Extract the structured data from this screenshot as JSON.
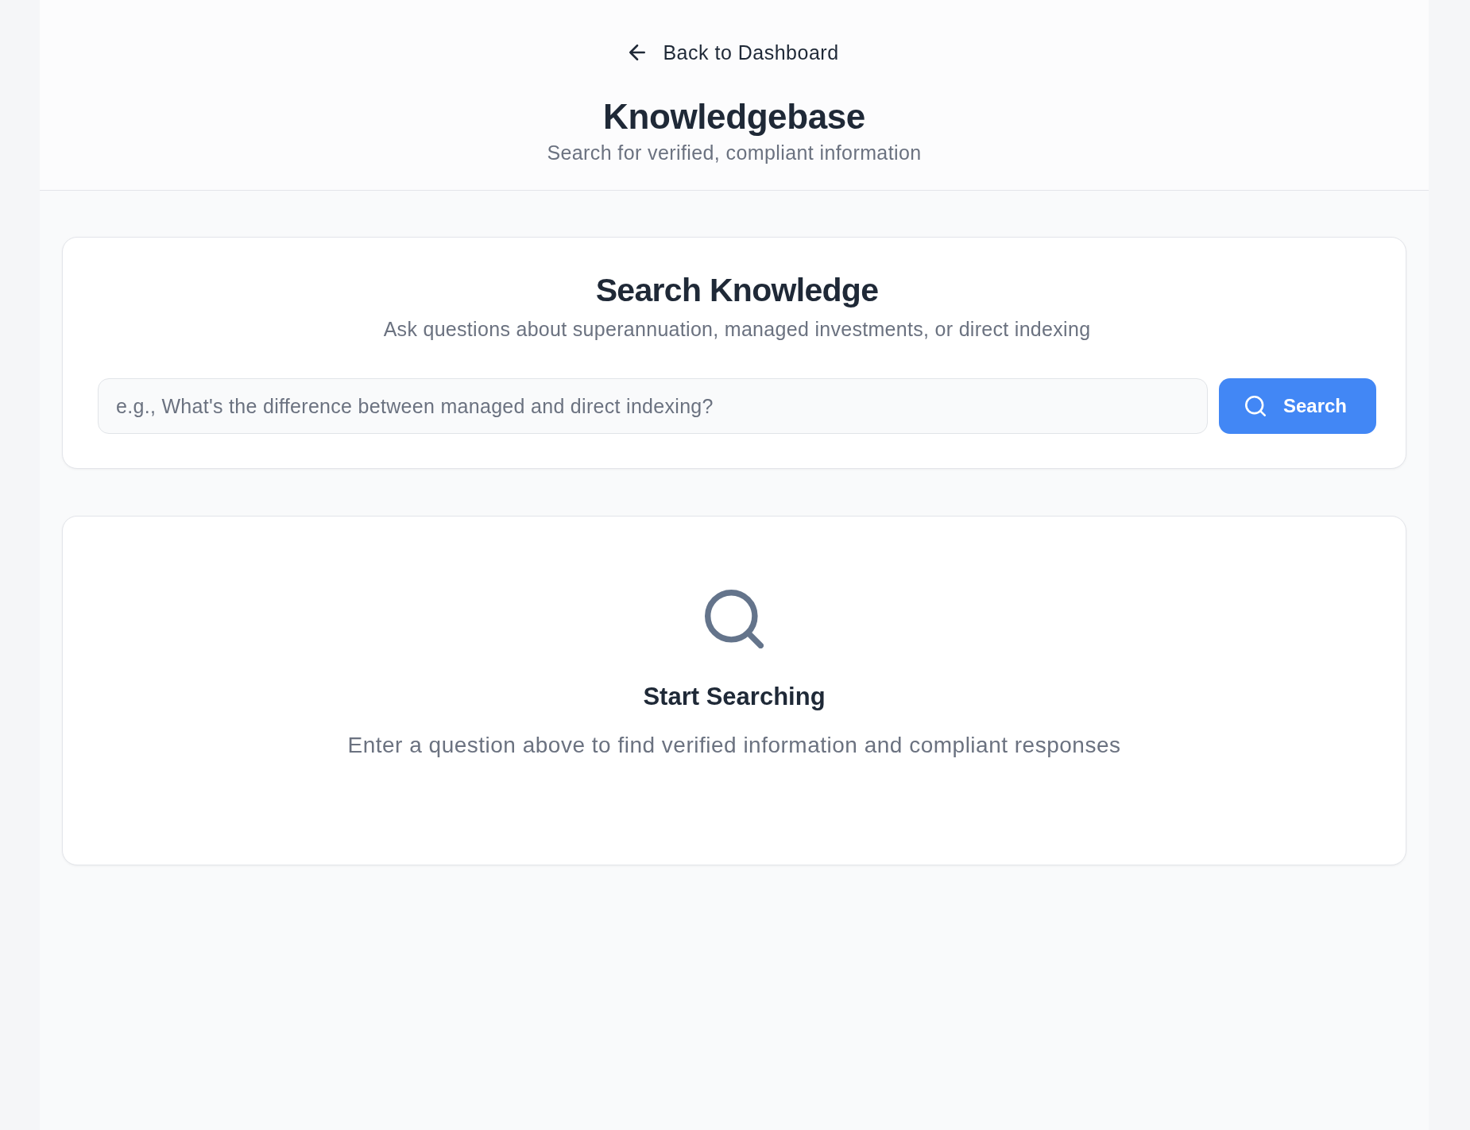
{
  "back_link": {
    "label": "Back to Dashboard"
  },
  "header": {
    "title": "Knowledgebase",
    "subtitle": "Search for verified, compliant information"
  },
  "search_card": {
    "title": "Search Knowledge",
    "subtitle": "Ask questions about superannuation, managed investments, or direct indexing",
    "search_field": {
      "placeholder": "e.g., What's the difference between managed and direct indexing?"
    },
    "search_button": {
      "label": "Search"
    }
  },
  "empty_state": {
    "title": "Start Searching",
    "message": "Enter a question above to find verified information and compliant responses"
  }
}
